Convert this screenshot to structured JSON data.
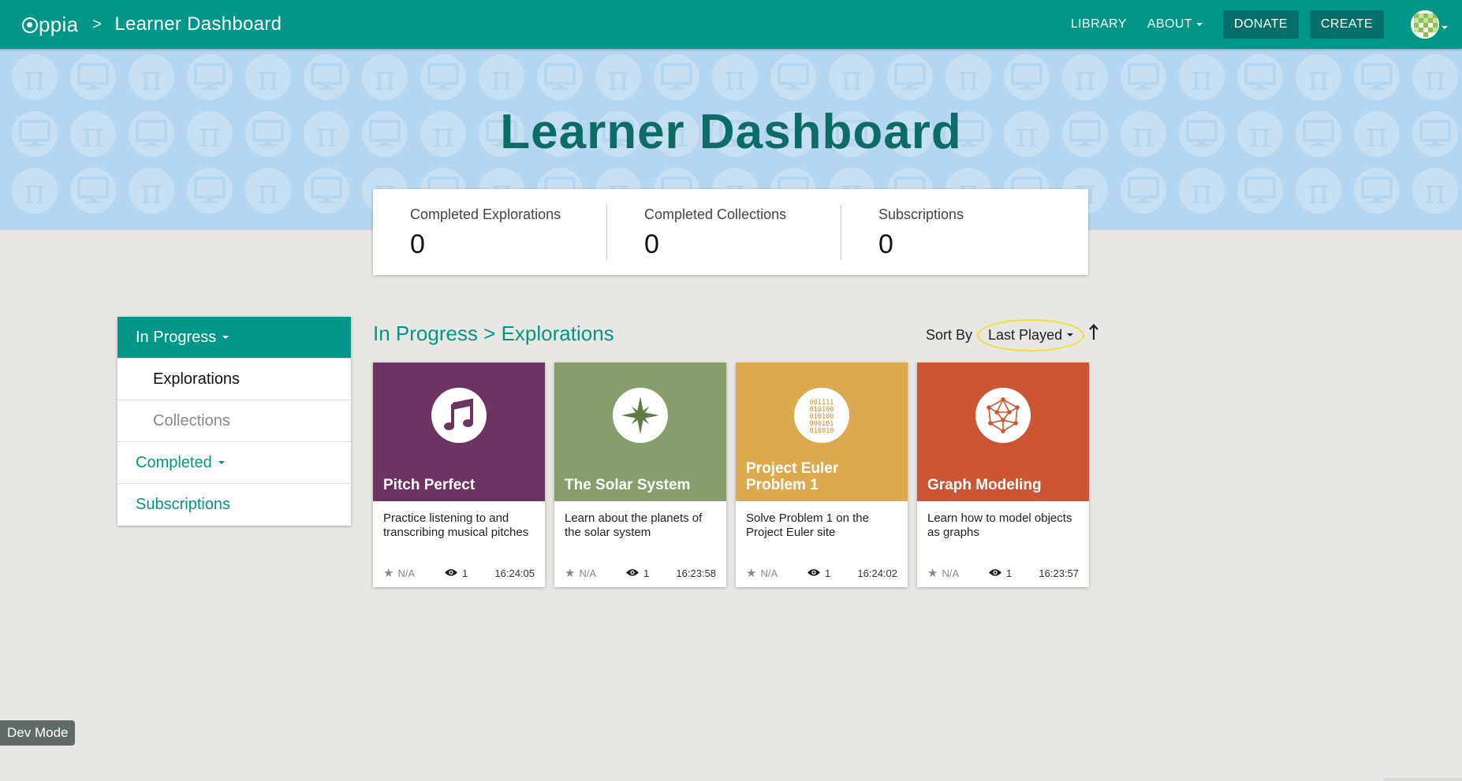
{
  "navbar": {
    "brand": "ppia",
    "separator": ">",
    "page": "Learner Dashboard",
    "links": [
      {
        "label": "LIBRARY"
      },
      {
        "label": "ABOUT"
      }
    ],
    "buttons": [
      {
        "label": "DONATE"
      },
      {
        "label": "CREATE"
      }
    ],
    "avatar_icon": "profile-avatar-icon"
  },
  "banner": {
    "title": "Learner Dashboard",
    "colors": {
      "background": "#b4d6f0",
      "title": "#0d6c66"
    }
  },
  "stats": [
    {
      "label": "Completed Explorations",
      "value": "0"
    },
    {
      "label": "Completed Collections",
      "value": "0"
    },
    {
      "label": "Subscriptions",
      "value": "0"
    }
  ],
  "sidebar": {
    "in_progress": "In Progress",
    "explorations": "Explorations",
    "collections": "Collections",
    "completed": "Completed",
    "subscriptions": "Subscriptions"
  },
  "section": {
    "title": "In Progress > Explorations",
    "sort_label": "Sort By",
    "sort_value": "Last Played",
    "sort_direction_icon": "arrow-up-icon"
  },
  "cards": [
    {
      "title": "Pitch Perfect",
      "description": "Practice listening to and transcribing musical pitches",
      "rating": "N/A",
      "views": "1",
      "time": "16:24:05",
      "color": "#6d3463",
      "icon": "music-note-icon"
    },
    {
      "title": "The Solar System",
      "description": "Learn about the planets of the solar system",
      "rating": "N/A",
      "views": "1",
      "time": "16:23:58",
      "color": "#859e6c",
      "icon": "star-compass-icon"
    },
    {
      "title": "Project Euler Problem 1",
      "description": "Solve Problem 1 on the Project Euler site",
      "rating": "N/A",
      "views": "1",
      "time": "16:24:02",
      "color": "#dca94f",
      "icon": "binary-code-icon",
      "binary_lines": [
        "001111",
        "010100",
        "010100",
        "000101",
        "010010"
      ]
    },
    {
      "title": "Graph Modeling",
      "description": "Learn how to model objects as graphs",
      "rating": "N/A",
      "views": "1",
      "time": "16:23:57",
      "color": "#cd5533",
      "icon": "graph-network-icon"
    }
  ],
  "dev_mode": "Dev Mode"
}
